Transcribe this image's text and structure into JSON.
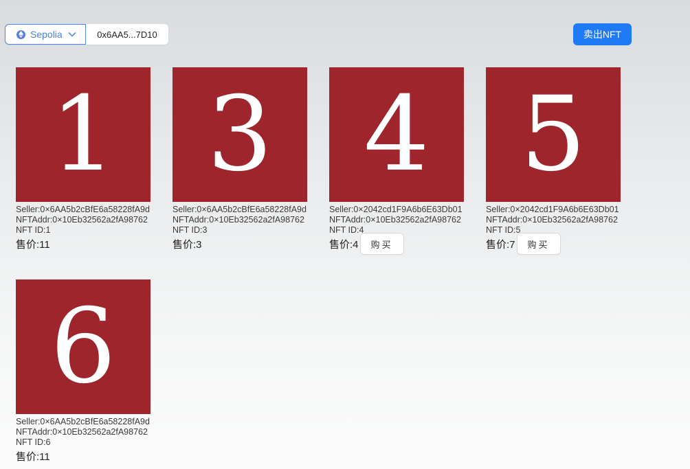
{
  "wallet": {
    "network": "Sepolia",
    "address": "0x6AA5...7D10"
  },
  "header": {
    "sell_label": "卖出NFT"
  },
  "cards": [
    {
      "image_number": "1",
      "seller": "Seller:0×6AA5b2cBfE6a58228fA9d",
      "nft_addr": "NFTAddr:0×10Eb32562a2fA98762",
      "nft_id": "NFT ID:1",
      "price": "售价:11",
      "buy_label": ""
    },
    {
      "image_number": "3",
      "seller": "Seller:0×6AA5b2cBfE6a58228fA9d",
      "nft_addr": "NFTAddr:0×10Eb32562a2fA98762",
      "nft_id": "NFT ID:3",
      "price": "售价:3",
      "buy_label": ""
    },
    {
      "image_number": "4",
      "seller": "Seller:0×2042cd1F9A6b6E63Db01",
      "nft_addr": "NFTAddr:0×10Eb32562a2fA98762",
      "nft_id": "NFT ID:4",
      "price": "售价:4",
      "buy_label": "购买"
    },
    {
      "image_number": "5",
      "seller": "Seller:0×2042cd1F9A6b6E63Db01",
      "nft_addr": "NFTAddr:0×10Eb32562a2fA98762",
      "nft_id": "NFT ID:5",
      "price": "售价:7",
      "buy_label": "购买"
    },
    {
      "image_number": "6",
      "seller": "Seller:0×6AA5b2cBfE6a58228fA9d",
      "nft_addr": "NFTAddr:0×10Eb32562a2fA98762",
      "nft_id": "NFT ID:6",
      "price": "售价:11",
      "buy_label": ""
    }
  ],
  "colors": {
    "accent": "#1f7af5",
    "network": "#4c7fd8",
    "nft_background": "#9e252b"
  },
  "icons": {
    "network": "ethereum-icon",
    "network_dropdown": "chevron-down-icon"
  }
}
